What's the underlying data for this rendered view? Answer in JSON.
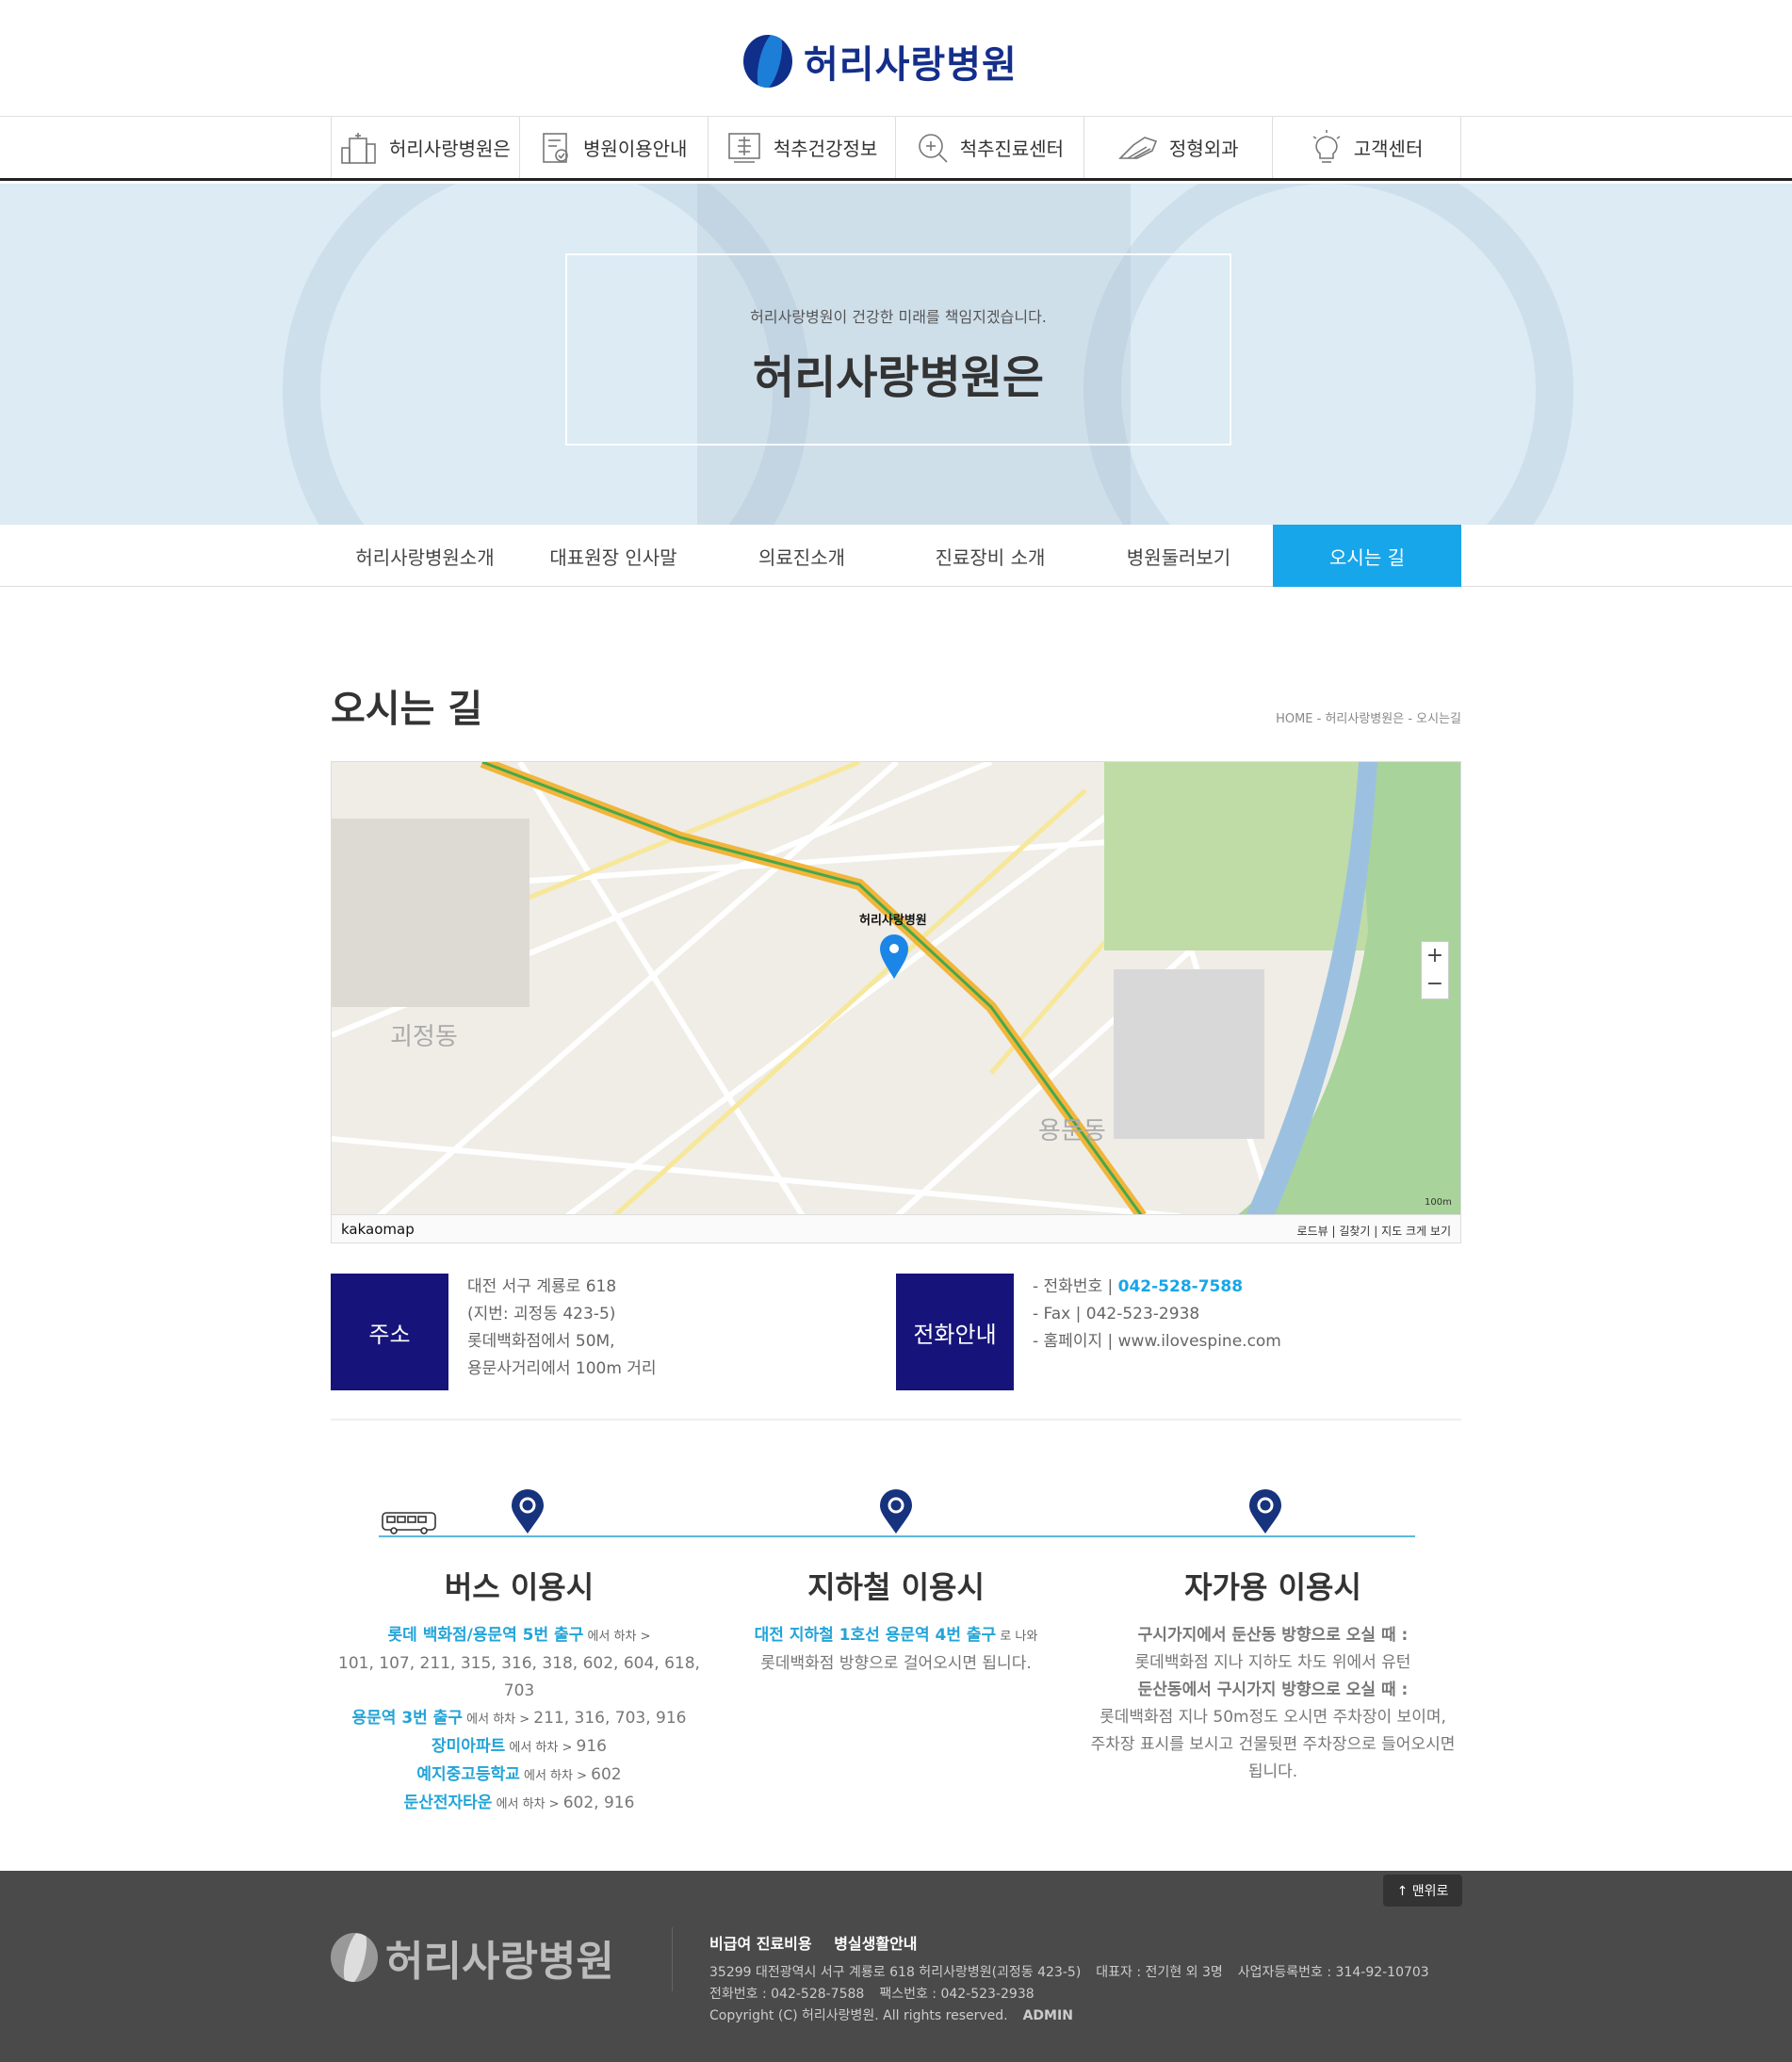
{
  "logo": {
    "text": "허리사랑병원"
  },
  "gnb": [
    {
      "label": "허리사랑병원은",
      "icon": "hospital-building-icon"
    },
    {
      "label": "병원이용안내",
      "icon": "clipboard-check-icon"
    },
    {
      "label": "척추건강정보",
      "icon": "spine-chart-icon"
    },
    {
      "label": "척추진료센터",
      "icon": "search-plus-icon"
    },
    {
      "label": "정형외과",
      "icon": "bone-joint-icon"
    },
    {
      "label": "고객센터",
      "icon": "lightbulb-icon"
    }
  ],
  "hero": {
    "subtitle": "허리사랑병원이 건강한 미래를 책임지겠습니다.",
    "title": "허리사랑병원은"
  },
  "snb": [
    "허리사랑병원소개",
    "대표원장 인사말",
    "의료진소개",
    "진료장비 소개",
    "병원둘러보기",
    "오시는 길"
  ],
  "page": {
    "title": "오시는 길",
    "breadcrumb": "HOME - 허리사랑병원은 - 오시는길"
  },
  "map": {
    "logo": "kakaomap",
    "links": "로드뷰 | 길찾기 | 지도 크게 보기",
    "marker_label": "허리사랑병원",
    "scale": "100m",
    "dong1": "괴정동",
    "dong2": "용문동",
    "zoom_in": "+",
    "zoom_out": "−"
  },
  "address": {
    "badge": "주소",
    "lines": [
      "대전 서구 계룡로 618",
      "(지번: 괴정동 423-5)",
      "롯데백화점에서 50M,",
      "용문사거리에서 100m 거리"
    ]
  },
  "contact": {
    "badge": "전화안내",
    "tel_label": "- 전화번호 | ",
    "tel": "042-528-7588",
    "fax": "- Fax | 042-523-2938",
    "homepage": "- 홈페이지 | www.ilovespine.com"
  },
  "bus": {
    "title": "버스 이용시",
    "l1a": "롯데 백화점/용문역 5번 출구",
    "l1b": " 에서 하차 >",
    "l2": "101, 107, 211, 315, 316, 318, 602, 604, 618, 703",
    "l3a": "용문역 3번 출구",
    "l3b": " 에서 하차 > ",
    "l3c": "211, 316, 703, 916",
    "l4a": "장미아파트",
    "l4b": " 에서 하차 > ",
    "l4c": "916",
    "l5a": "예지중고등학교",
    "l5b": " 에서 하차 > ",
    "l5c": "602",
    "l6a": "둔산전자타운",
    "l6b": " 에서 하차 > ",
    "l6c": "602, 916"
  },
  "subway": {
    "title": "지하철 이용시",
    "l1a": "대전 지하철 1호선 용문역 4번 출구",
    "l1b": " 로 나와",
    "l2": "롯데백화점 방향으로 걸어오시면 됩니다."
  },
  "car": {
    "title": "자가용 이용시",
    "l1": "구시가지에서 둔산동 방향으로 오실 때 :",
    "l2": "롯데백화점 지나 지하도 차도 위에서 유턴",
    "l3": "둔산동에서 구시가지 방향으로 오실 때 :",
    "l4": "롯데백화점 지나 50m정도 오시면 주차장이 보이며,",
    "l5": "주차장 표시를 보시고 건물뒷편 주차장으로 들어오시면",
    "l6": "됩니다."
  },
  "footer": {
    "top": "↑ 맨위로",
    "logo": "허리사랑병원",
    "link1": "비급여 진료비용",
    "link2": "병실생활안내",
    "addr": "35299 대전광역시 서구 계룡로 618 허리사랑병원(괴정동 423-5)",
    "ceo": "대표자 : 전기현 외 3명",
    "biz": "사업자등록번호 : 314-92-10703",
    "tel": "전화번호 : 042-528-7588",
    "fax": "팩스번호 : 042-523-2938",
    "copy": "Copyright (C) 허리사랑병원. All rights reserved.",
    "admin": "ADMIN"
  },
  "colors": {
    "accent": "#17a6ea",
    "navy": "#16147a",
    "brand": "#142e8a",
    "footer_bg": "#4a4a4a"
  }
}
